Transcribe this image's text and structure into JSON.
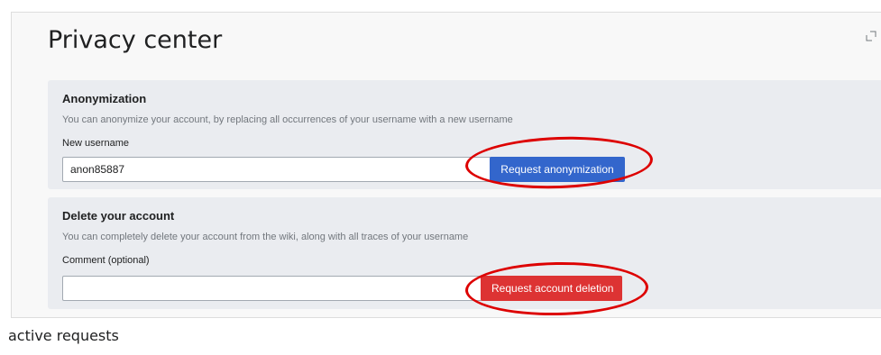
{
  "page": {
    "title": "Privacy center"
  },
  "anonymization": {
    "heading": "Anonymization",
    "description": "You can anonymize your account, by replacing all occurrences of your username with a new username",
    "field_label": "New username",
    "field_value": "anon85887",
    "button_label": "Request anonymization"
  },
  "delete_account": {
    "heading": "Delete your account",
    "description": "You can completely delete your account from the wiki, along with all traces of your username",
    "field_label": "Comment (optional)",
    "field_value": "",
    "button_label": "Request account deletion"
  },
  "footer": {
    "label": "active requests"
  },
  "colors": {
    "primary_button": "#3366cc",
    "destructive_button": "#dd3333",
    "annotation": "#dd0000",
    "panel_background": "#eaecf0"
  },
  "icons": {
    "expand": "expand-icon"
  }
}
